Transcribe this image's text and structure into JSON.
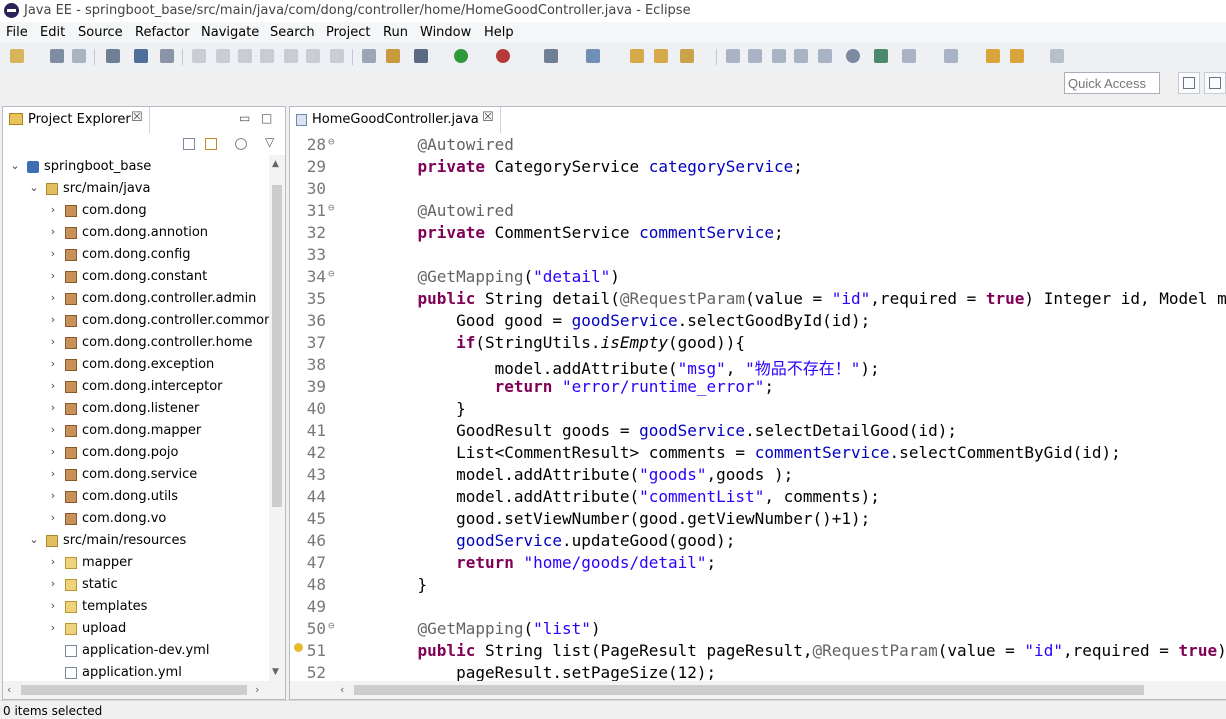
{
  "window": {
    "title": "Java EE - springboot_base/src/main/java/com/dong/controller/home/HomeGoodController.java - Eclipse"
  },
  "menu": [
    "File",
    "Edit",
    "Source",
    "Refactor",
    "Navigate",
    "Search",
    "Project",
    "Run",
    "Window",
    "Help"
  ],
  "quick_access": {
    "placeholder": "Quick Access"
  },
  "explorer": {
    "tab_label": "Project Explorer",
    "close_glyph": "☒",
    "items": [
      {
        "label": "springboot_base",
        "icon": "project-icon",
        "indent": 0,
        "twisty": "down"
      },
      {
        "label": "src/main/java",
        "icon": "source-folder-icon",
        "indent": 1,
        "twisty": "down"
      },
      {
        "label": "com.dong",
        "icon": "package-icon",
        "indent": 2,
        "twisty": "right"
      },
      {
        "label": "com.dong.annotion",
        "icon": "package-icon",
        "indent": 2,
        "twisty": "right"
      },
      {
        "label": "com.dong.config",
        "icon": "package-icon",
        "indent": 2,
        "twisty": "right"
      },
      {
        "label": "com.dong.constant",
        "icon": "package-icon",
        "indent": 2,
        "twisty": "right"
      },
      {
        "label": "com.dong.controller.admin",
        "icon": "package-icon",
        "indent": 2,
        "twisty": "right"
      },
      {
        "label": "com.dong.controller.common",
        "icon": "package-icon",
        "indent": 2,
        "twisty": "right"
      },
      {
        "label": "com.dong.controller.home",
        "icon": "package-icon",
        "indent": 2,
        "twisty": "right"
      },
      {
        "label": "com.dong.exception",
        "icon": "package-icon",
        "indent": 2,
        "twisty": "right"
      },
      {
        "label": "com.dong.interceptor",
        "icon": "package-icon",
        "indent": 2,
        "twisty": "right"
      },
      {
        "label": "com.dong.listener",
        "icon": "package-icon",
        "indent": 2,
        "twisty": "right"
      },
      {
        "label": "com.dong.mapper",
        "icon": "package-icon",
        "indent": 2,
        "twisty": "right"
      },
      {
        "label": "com.dong.pojo",
        "icon": "package-icon",
        "indent": 2,
        "twisty": "right"
      },
      {
        "label": "com.dong.service",
        "icon": "package-icon",
        "indent": 2,
        "twisty": "right"
      },
      {
        "label": "com.dong.utils",
        "icon": "package-icon",
        "indent": 2,
        "twisty": "right"
      },
      {
        "label": "com.dong.vo",
        "icon": "package-icon",
        "indent": 2,
        "twisty": "right"
      },
      {
        "label": "src/main/resources",
        "icon": "source-folder-icon",
        "indent": 1,
        "twisty": "down"
      },
      {
        "label": "mapper",
        "icon": "folder-icon",
        "indent": 2,
        "twisty": "right"
      },
      {
        "label": "static",
        "icon": "folder-icon",
        "indent": 2,
        "twisty": "right"
      },
      {
        "label": "templates",
        "icon": "folder-icon",
        "indent": 2,
        "twisty": "right"
      },
      {
        "label": "upload",
        "icon": "folder-icon",
        "indent": 2,
        "twisty": "right"
      },
      {
        "label": "application-dev.yml",
        "icon": "file-icon",
        "indent": 2,
        "twisty": ""
      },
      {
        "label": "application.yml",
        "icon": "file-icon",
        "indent": 2,
        "twisty": ""
      }
    ]
  },
  "editor": {
    "tab_label": "HomeGoodController.java",
    "close_glyph": "☒",
    "colors": {
      "keyword": "#7f0055",
      "annotation": "#646464",
      "string": "#2a00ff",
      "field": "#0000c0",
      "default": "#000000"
    },
    "lines": [
      {
        "num": "28",
        "fold": true,
        "warn": false,
        "tokens": [
          [
            "    ",
            "default"
          ],
          [
            "@Autowired",
            "annotation"
          ]
        ]
      },
      {
        "num": "29",
        "fold": false,
        "warn": false,
        "tokens": [
          [
            "    ",
            "default"
          ],
          [
            "private",
            "keyword"
          ],
          [
            " CategoryService ",
            "default"
          ],
          [
            "categoryService",
            "field"
          ],
          [
            ";",
            "default"
          ]
        ]
      },
      {
        "num": "30",
        "fold": false,
        "warn": false,
        "tokens": []
      },
      {
        "num": "31",
        "fold": true,
        "warn": false,
        "tokens": [
          [
            "    ",
            "default"
          ],
          [
            "@Autowired",
            "annotation"
          ]
        ]
      },
      {
        "num": "32",
        "fold": false,
        "warn": false,
        "tokens": [
          [
            "    ",
            "default"
          ],
          [
            "private",
            "keyword"
          ],
          [
            " CommentService ",
            "default"
          ],
          [
            "commentService",
            "field"
          ],
          [
            ";",
            "default"
          ]
        ]
      },
      {
        "num": "33",
        "fold": false,
        "warn": false,
        "tokens": []
      },
      {
        "num": "34",
        "fold": true,
        "warn": false,
        "tokens": [
          [
            "    ",
            "default"
          ],
          [
            "@GetMapping",
            "annotation"
          ],
          [
            "(",
            "default"
          ],
          [
            "\"detail\"",
            "string"
          ],
          [
            ")",
            "default"
          ]
        ]
      },
      {
        "num": "35",
        "fold": false,
        "warn": false,
        "tokens": [
          [
            "    ",
            "default"
          ],
          [
            "public",
            "keyword"
          ],
          [
            " String detail(",
            "default"
          ],
          [
            "@RequestParam",
            "annotation"
          ],
          [
            "(value = ",
            "default"
          ],
          [
            "\"id\"",
            "string"
          ],
          [
            ",required = ",
            "default"
          ],
          [
            "true",
            "keyword"
          ],
          [
            ") Integer id, Model mo",
            "default"
          ]
        ]
      },
      {
        "num": "36",
        "fold": false,
        "warn": false,
        "tokens": [
          [
            "        Good good = ",
            "default"
          ],
          [
            "goodService",
            "field"
          ],
          [
            ".selectGoodById(id);",
            "default"
          ]
        ]
      },
      {
        "num": "37",
        "fold": false,
        "warn": false,
        "tokens": [
          [
            "        ",
            "default"
          ],
          [
            "if",
            "keyword"
          ],
          [
            "(StringUtils.",
            "default"
          ],
          [
            "isEmpty",
            "italic"
          ],
          [
            "(good)){",
            "default"
          ]
        ]
      },
      {
        "num": "38",
        "fold": false,
        "warn": false,
        "tokens": [
          [
            "            model.addAttribute(",
            "default"
          ],
          [
            "\"msg\"",
            "string"
          ],
          [
            ", ",
            "default"
          ],
          [
            "\"物品不存在！\"",
            "string"
          ],
          [
            ");",
            "default"
          ]
        ]
      },
      {
        "num": "39",
        "fold": false,
        "warn": false,
        "tokens": [
          [
            "            ",
            "default"
          ],
          [
            "return",
            "keyword"
          ],
          [
            " ",
            "default"
          ],
          [
            "\"error/runtime_error\"",
            "string"
          ],
          [
            ";",
            "default"
          ]
        ]
      },
      {
        "num": "40",
        "fold": false,
        "warn": false,
        "tokens": [
          [
            "        }",
            "default"
          ]
        ]
      },
      {
        "num": "41",
        "fold": false,
        "warn": false,
        "tokens": [
          [
            "        GoodResult goods = ",
            "default"
          ],
          [
            "goodService",
            "field"
          ],
          [
            ".selectDetailGood(id);",
            "default"
          ]
        ]
      },
      {
        "num": "42",
        "fold": false,
        "warn": false,
        "tokens": [
          [
            "        List<CommentResult> comments = ",
            "default"
          ],
          [
            "commentService",
            "field"
          ],
          [
            ".selectCommentByGid(id);",
            "default"
          ]
        ]
      },
      {
        "num": "43",
        "fold": false,
        "warn": false,
        "tokens": [
          [
            "        model.addAttribute(",
            "default"
          ],
          [
            "\"goods\"",
            "string"
          ],
          [
            ",goods );",
            "default"
          ]
        ]
      },
      {
        "num": "44",
        "fold": false,
        "warn": false,
        "tokens": [
          [
            "        model.addAttribute(",
            "default"
          ],
          [
            "\"commentList\"",
            "string"
          ],
          [
            ", comments);",
            "default"
          ]
        ]
      },
      {
        "num": "45",
        "fold": false,
        "warn": false,
        "tokens": [
          [
            "        good.setViewNumber(good.getViewNumber()+1);",
            "default"
          ]
        ]
      },
      {
        "num": "46",
        "fold": false,
        "warn": false,
        "tokens": [
          [
            "        ",
            "default"
          ],
          [
            "goodService",
            "field"
          ],
          [
            ".updateGood(good);",
            "default"
          ]
        ]
      },
      {
        "num": "47",
        "fold": false,
        "warn": false,
        "tokens": [
          [
            "        ",
            "default"
          ],
          [
            "return",
            "keyword"
          ],
          [
            " ",
            "default"
          ],
          [
            "\"home/goods/detail\"",
            "string"
          ],
          [
            ";",
            "default"
          ]
        ]
      },
      {
        "num": "48",
        "fold": false,
        "warn": false,
        "tokens": [
          [
            "    }",
            "default"
          ]
        ]
      },
      {
        "num": "49",
        "fold": false,
        "warn": false,
        "tokens": []
      },
      {
        "num": "50",
        "fold": true,
        "warn": false,
        "tokens": [
          [
            "    ",
            "default"
          ],
          [
            "@GetMapping",
            "annotation"
          ],
          [
            "(",
            "default"
          ],
          [
            "\"list\"",
            "string"
          ],
          [
            ")",
            "default"
          ]
        ]
      },
      {
        "num": "51",
        "fold": false,
        "warn": true,
        "tokens": [
          [
            "    ",
            "default"
          ],
          [
            "public",
            "keyword"
          ],
          [
            " String list(PageResult pageResult,",
            "default"
          ],
          [
            "@RequestParam",
            "annotation"
          ],
          [
            "(value = ",
            "default"
          ],
          [
            "\"id\"",
            "string"
          ],
          [
            ",required = ",
            "default"
          ],
          [
            "true",
            "keyword"
          ],
          [
            ")I",
            "default"
          ]
        ]
      },
      {
        "num": "52",
        "fold": false,
        "warn": false,
        "tokens": [
          [
            "        pageResult.setPageSize(12);",
            "default"
          ]
        ]
      }
    ]
  },
  "status": {
    "text": "0 items selected"
  }
}
